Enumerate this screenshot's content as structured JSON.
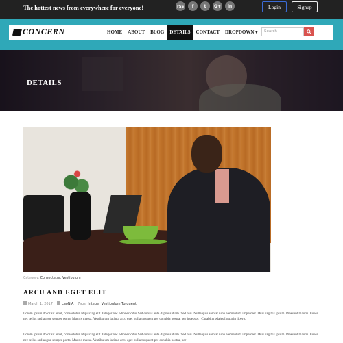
{
  "topbar": {
    "tagline": "The hottest news from everywhere for everyone!",
    "social": [
      "rss-icon",
      "facebook-icon",
      "twitter-icon",
      "google-plus-icon",
      "linkedin-icon"
    ],
    "social_glyphs": [
      "rss",
      "f",
      "t",
      "G+",
      "in"
    ],
    "login_label": "Login",
    "signup_label": "Signup"
  },
  "navbar": {
    "logo_text": "CONCERN",
    "menu": [
      "HOME",
      "ABOUT",
      "BLOG",
      "DETAILS",
      "CONTACT",
      "DROPDOWN ▾"
    ],
    "active_item": "DETAILS",
    "search_placeholder": "Search",
    "search_icon": "search-icon"
  },
  "hero": {
    "title": "DETAILS"
  },
  "post": {
    "category_label": "Category:",
    "categories": "Consectetur, Vestibulum",
    "title": "ARCU AND EGET ELIT",
    "date": "March 1, 2017",
    "author": "LaoNIA",
    "tags_label": "Tags:",
    "tags": "Integer Vestibulum Torquent",
    "paragraph1": "Lorem ipsum dolor sit amet, consectetur adipiscing elit. Integer nec odionec odio.Sed cursus ante dapibus diam. Sed nisi. Nulla quis sem at nibh elementum imperdiet. Duis sagittis ipsum. Praesent mauris. Fusce nec tellus sed augue semper porta. Mauris massa. Vestibulum lacinia arcu eget nulla.torquent per conubia nostra, per inceptos . Curabiturodales ligula in libero.",
    "paragraph2": "Lorem ipsum dolor sit amet, consectetur adipiscing elit. Integer nec odionec odio.Sed cursus ante dapibus diam. Sed nisi. Nulla quis sem at nibh elementum imperdiet. Duis sagittis ipsum. Praesent mauris. Fusce nec tellus sed augue semper porta. Mauris massa. Vestibulum lacinia arcu eget nulla.torquent per conubia nostra, per"
  },
  "colors": {
    "nav_band": "#2fa8b8",
    "topbar": "#222222",
    "search_button": "#d9534f",
    "active_menu": "#111111"
  }
}
